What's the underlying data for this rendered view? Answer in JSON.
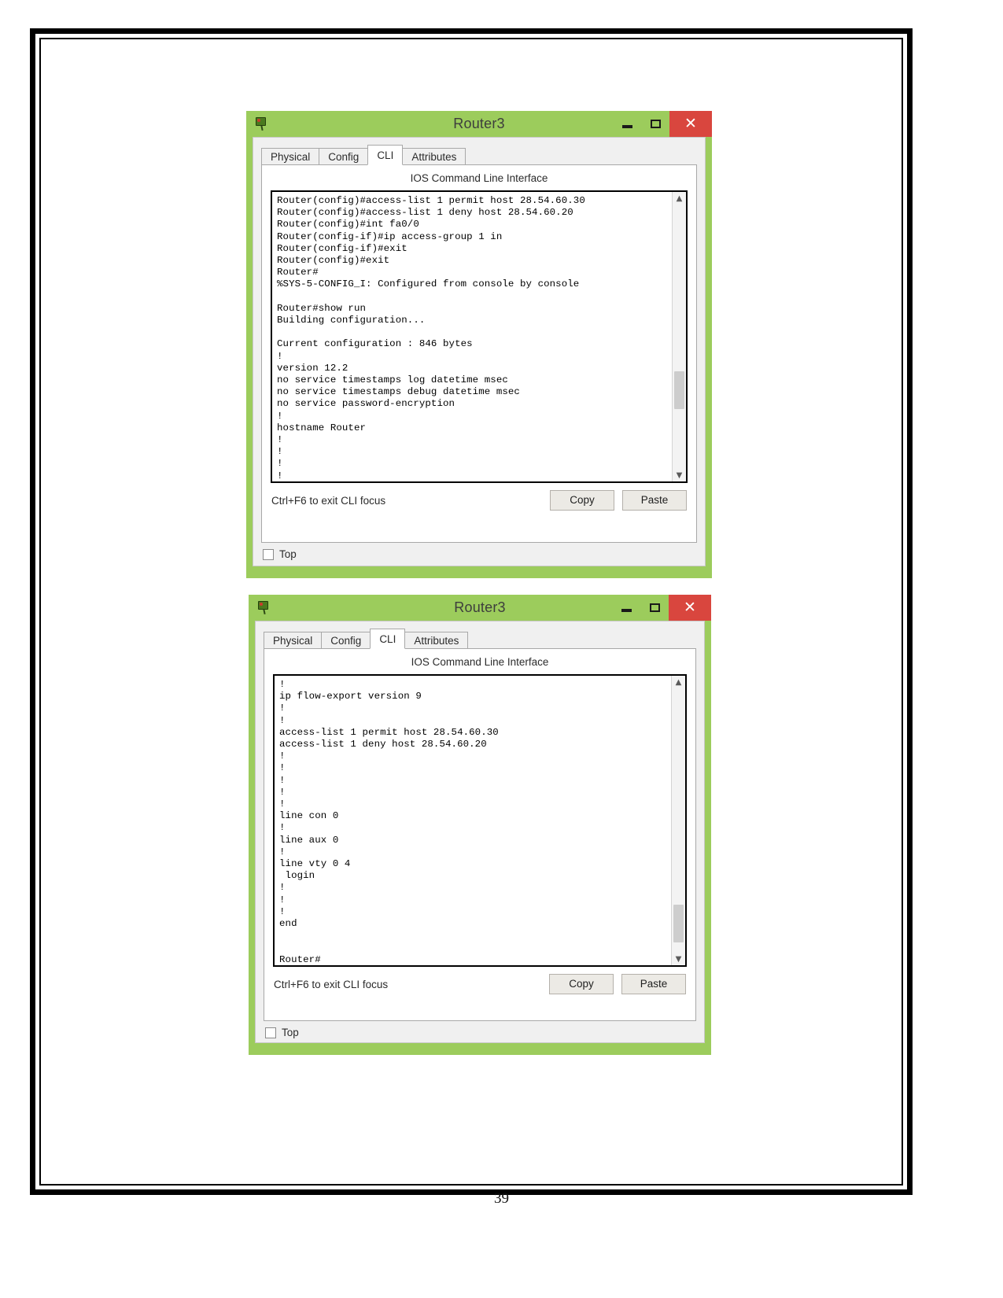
{
  "document": {
    "page_number": "39"
  },
  "windows": [
    {
      "title": "Router3",
      "icon": "packet-tracer-device-icon",
      "controls": {
        "minimize": "–",
        "maximize": "□",
        "close": "✕"
      },
      "tabs": [
        {
          "label": "Physical",
          "active": false
        },
        {
          "label": "Config",
          "active": false
        },
        {
          "label": "CLI",
          "active": true
        },
        {
          "label": "Attributes",
          "active": false
        }
      ],
      "panel_heading": "IOS Command Line Interface",
      "terminal_text": "Router(config)#access-list 1 permit host 28.54.60.30\nRouter(config)#access-list 1 deny host 28.54.60.20\nRouter(config)#int fa0/0\nRouter(config-if)#ip access-group 1 in\nRouter(config-if)#exit\nRouter(config)#exit\nRouter#\n%SYS-5-CONFIG_I: Configured from console by console\n\nRouter#show run\nBuilding configuration...\n\nCurrent configuration : 846 bytes\n!\nversion 12.2\nno service timestamps log datetime msec\nno service timestamps debug datetime msec\nno service password-encryption\n!\nhostname Router\n!\n!\n!\n!",
      "hint": "Ctrl+F6 to exit CLI focus",
      "copy_label": "Copy",
      "paste_label": "Paste",
      "top_label": "Top",
      "top_checked": false,
      "scroll": {
        "up_arrow": "▲",
        "down_arrow": "▼",
        "thumb_top_pct": 62,
        "thumb_height_pct": 13
      }
    },
    {
      "title": "Router3",
      "icon": "packet-tracer-device-icon",
      "controls": {
        "minimize": "–",
        "maximize": "□",
        "close": "✕"
      },
      "tabs": [
        {
          "label": "Physical",
          "active": false
        },
        {
          "label": "Config",
          "active": false
        },
        {
          "label": "CLI",
          "active": true
        },
        {
          "label": "Attributes",
          "active": false
        }
      ],
      "panel_heading": "IOS Command Line Interface",
      "terminal_text": "!\nip flow-export version 9\n!\n!\naccess-list 1 permit host 28.54.60.30\naccess-list 1 deny host 28.54.60.20\n!\n!\n!\n!\n!\nline con 0\n!\nline aux 0\n!\nline vty 0 4\n login\n!\n!\n!\nend\n\n\nRouter#\nRouter#",
      "hint": "Ctrl+F6 to exit CLI focus",
      "copy_label": "Copy",
      "paste_label": "Paste",
      "top_label": "Top",
      "top_checked": false,
      "scroll": {
        "up_arrow": "▲",
        "down_arrow": "▼",
        "thumb_top_pct": 79,
        "thumb_height_pct": 13
      }
    }
  ],
  "colors": {
    "window_chrome": "#9ccc5c",
    "close_button": "#d9463e",
    "client_bg": "#f0f0f0",
    "panel_bg": "#ffffff"
  }
}
